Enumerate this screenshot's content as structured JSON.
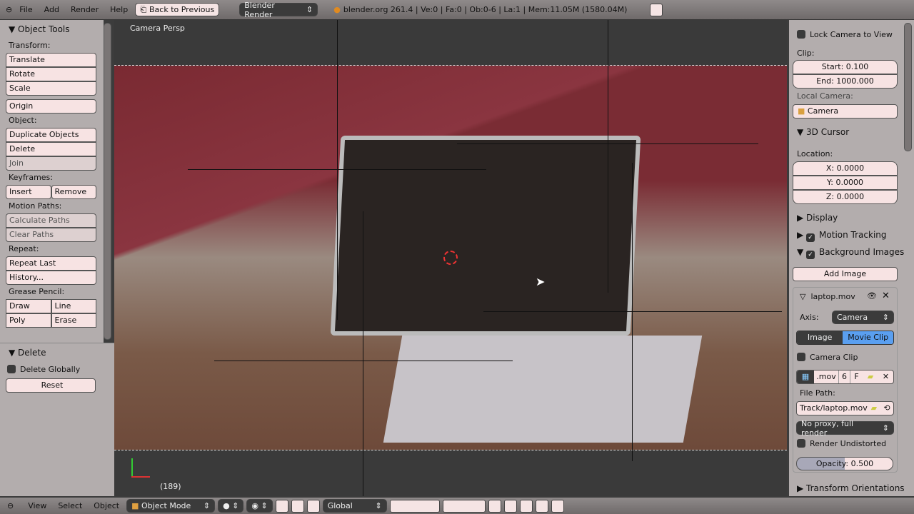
{
  "topbar": {
    "menus": [
      "File",
      "Add",
      "Render",
      "Help"
    ],
    "back_button": "Back to Previous",
    "engine": "Blender Render",
    "stats": "blender.org 261.4 | Ve:0 | Fa:0 | Ob:0-6 | La:1 | Mem:11.05M (1580.04M)"
  },
  "left_panel": {
    "title": "Object Tools",
    "transform_label": "Transform:",
    "translate": "Translate",
    "rotate": "Rotate",
    "scale": "Scale",
    "origin": "Origin",
    "object_label": "Object:",
    "duplicate": "Duplicate Objects",
    "delete": "Delete",
    "join": "Join",
    "keyframes_label": "Keyframes:",
    "insert": "Insert",
    "remove": "Remove",
    "motion_label": "Motion Paths:",
    "calc_paths": "Calculate Paths",
    "clear_paths": "Clear Paths",
    "repeat_label": "Repeat:",
    "repeat_last": "Repeat Last",
    "history": "History...",
    "grease_label": "Grease Pencil:",
    "draw": "Draw",
    "line": "Line",
    "poly": "Poly",
    "erase": "Erase",
    "op_title": "Delete",
    "delete_globally": "Delete Globally",
    "reset": "Reset"
  },
  "viewport": {
    "label": "Camera Persp",
    "frame": "(189)"
  },
  "right_panel": {
    "lock_camera": "Lock Camera to View",
    "clip_label": "Clip:",
    "clip_start": "Start: 0.100",
    "clip_end": "End: 1000.000",
    "local_camera_label": "Local Camera:",
    "local_camera": "Camera",
    "cursor_title": "3D Cursor",
    "location_label": "Location:",
    "x": "X: 0.0000",
    "y": "Y: 0.0000",
    "z": "Z: 0.0000",
    "display": "Display",
    "motion_tracking": "Motion Tracking",
    "background_images": "Background Images",
    "add_image": "Add Image",
    "bg_name": "laptop.mov",
    "axis_label": "Axis:",
    "axis_value": "Camera",
    "tab_image": "Image",
    "tab_clip": "Movie Clip",
    "camera_clip": "Camera Clip",
    "clip_ext": ".mov",
    "clip_users": "6",
    "clip_fake": "F",
    "file_path_label": "File Path:",
    "file_path": "Track/laptop.mov",
    "proxy": "No proxy, full render",
    "render_undistorted": "Render Undistorted",
    "opacity": "Opacity: 0.500",
    "opacity_value": 0.5,
    "transform_orientations": "Transform Orientations"
  },
  "bottombar": {
    "menus": [
      "View",
      "Select",
      "Object"
    ],
    "mode": "Object Mode",
    "orientation": "Global"
  },
  "colors": {
    "accent": "#5a9ff0",
    "panel": "#b3adad",
    "button": "#f7e3e3"
  }
}
